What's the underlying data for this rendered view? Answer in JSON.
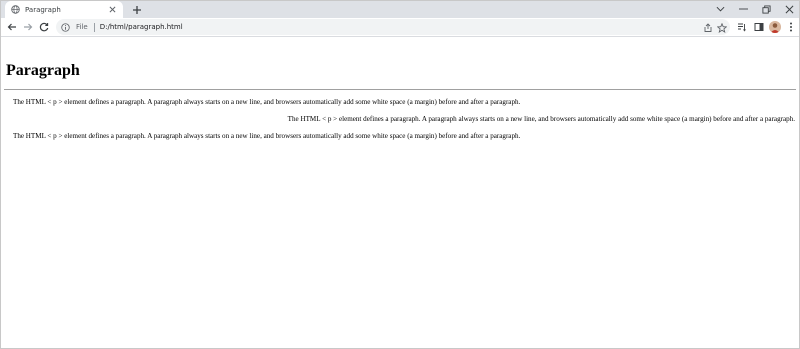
{
  "browser": {
    "tab": {
      "title": "Paragraph",
      "favicon": "globe-icon"
    },
    "new_tab_label": "+",
    "address_bar": {
      "scheme_label": "File",
      "url": "D:/html/paragraph.html"
    },
    "accent_color": "#1a73e8"
  },
  "page": {
    "heading": "Paragraph",
    "paragraphs": [
      {
        "text": "The HTML < p > element defines a paragraph. A paragraph always starts on a new line, and browsers automatically add some white space (a margin) before and after a paragraph.",
        "align": "left"
      },
      {
        "text": "The HTML < p > element defines a paragraph. A paragraph always starts on a new line, and browsers automatically add some white space (a margin) before and after a paragraph.",
        "align": "right"
      },
      {
        "text": "The HTML < p > element defines a paragraph. A paragraph always starts on a new line, and browsers automatically add some white space (a margin) before and after a paragraph.",
        "align": "left"
      }
    ]
  }
}
